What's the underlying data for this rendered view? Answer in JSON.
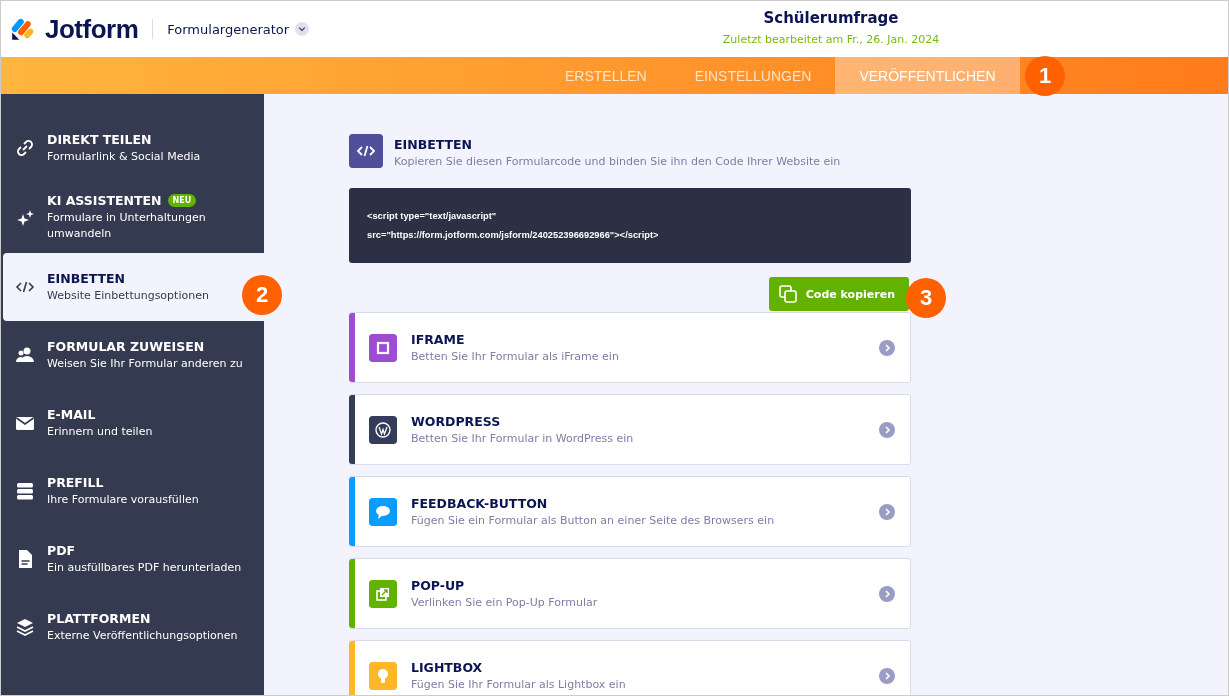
{
  "header": {
    "logo": "Jotform",
    "product_menu": "Formulargenerator",
    "form_title": "Schülerumfrage",
    "last_edited": "Zuletzt bearbeitet am Fr., 26. Jan. 2024"
  },
  "tabs": [
    {
      "label": "ERSTELLEN",
      "selected": false
    },
    {
      "label": "EINSTELLUNGEN",
      "selected": false
    },
    {
      "label": "VERÖFFENTLICHEN",
      "selected": true
    }
  ],
  "sidebar": {
    "items": [
      {
        "kind": "link",
        "title": "DIREKT TEILEN",
        "subtitle": "Formularlink & Social Media",
        "selected": false
      },
      {
        "kind": "sparkle",
        "title": "KI ASSISTENTEN",
        "badge": "NEU",
        "subtitle": "Formulare in Unterhaltungen umwandeln",
        "selected": false
      },
      {
        "kind": "code",
        "title": "EINBETTEN",
        "subtitle": "Website Einbettungsoptionen",
        "selected": true
      },
      {
        "kind": "people",
        "title": "FORMULAR ZUWEISEN",
        "subtitle": "Weisen Sie Ihr Formular anderen zu",
        "selected": false
      },
      {
        "kind": "mail",
        "title": "E-MAIL",
        "subtitle": "Erinnern und teilen",
        "selected": false
      },
      {
        "kind": "prefill",
        "title": "PREFILL",
        "subtitle": "Ihre Formulare vorausfüllen",
        "selected": false
      },
      {
        "kind": "pdf",
        "title": "PDF",
        "subtitle": "Ein ausfüllbares PDF herunterladen",
        "selected": false
      },
      {
        "kind": "layers",
        "title": "PLATTFORMEN",
        "subtitle": "Externe Veröffentlichungsoptionen",
        "selected": false
      }
    ]
  },
  "embed": {
    "title": "EINBETTEN",
    "description": "Kopieren Sie diesen Formularcode und binden Sie ihn den Code Ihrer Website ein",
    "code_lines": [
      "<script type=\"text/javascript\"",
      "src=\"https://form.jotform.com/jsform/240252396692966\"></script>"
    ],
    "copy_button": "Code kopieren"
  },
  "options": [
    {
      "kind": "iframe",
      "color": "#9c4dd3",
      "title": "IFRAME",
      "description": "Betten Sie Ihr Formular als iFrame ein"
    },
    {
      "kind": "wordpress",
      "color": "#343c5a",
      "title": "WORDPRESS",
      "description": "Betten Sie Ihr Formular in WordPress ein"
    },
    {
      "kind": "feedback",
      "color": "#0a9cff",
      "title": "FEEDBACK-BUTTON",
      "description": "Fügen Sie ein Formular als Button an einer Seite des Browsers ein"
    },
    {
      "kind": "popup",
      "color": "#64b200",
      "title": "POP-UP",
      "description": "Verlinken Sie ein Pop-Up Formular"
    },
    {
      "kind": "lightbox",
      "color": "#ffb629",
      "title": "LIGHTBOX",
      "description": "Fügen Sie Ihr Formular als Lightbox ein"
    }
  ],
  "callouts": [
    {
      "label": "1"
    },
    {
      "label": "2"
    },
    {
      "label": "3"
    }
  ]
}
